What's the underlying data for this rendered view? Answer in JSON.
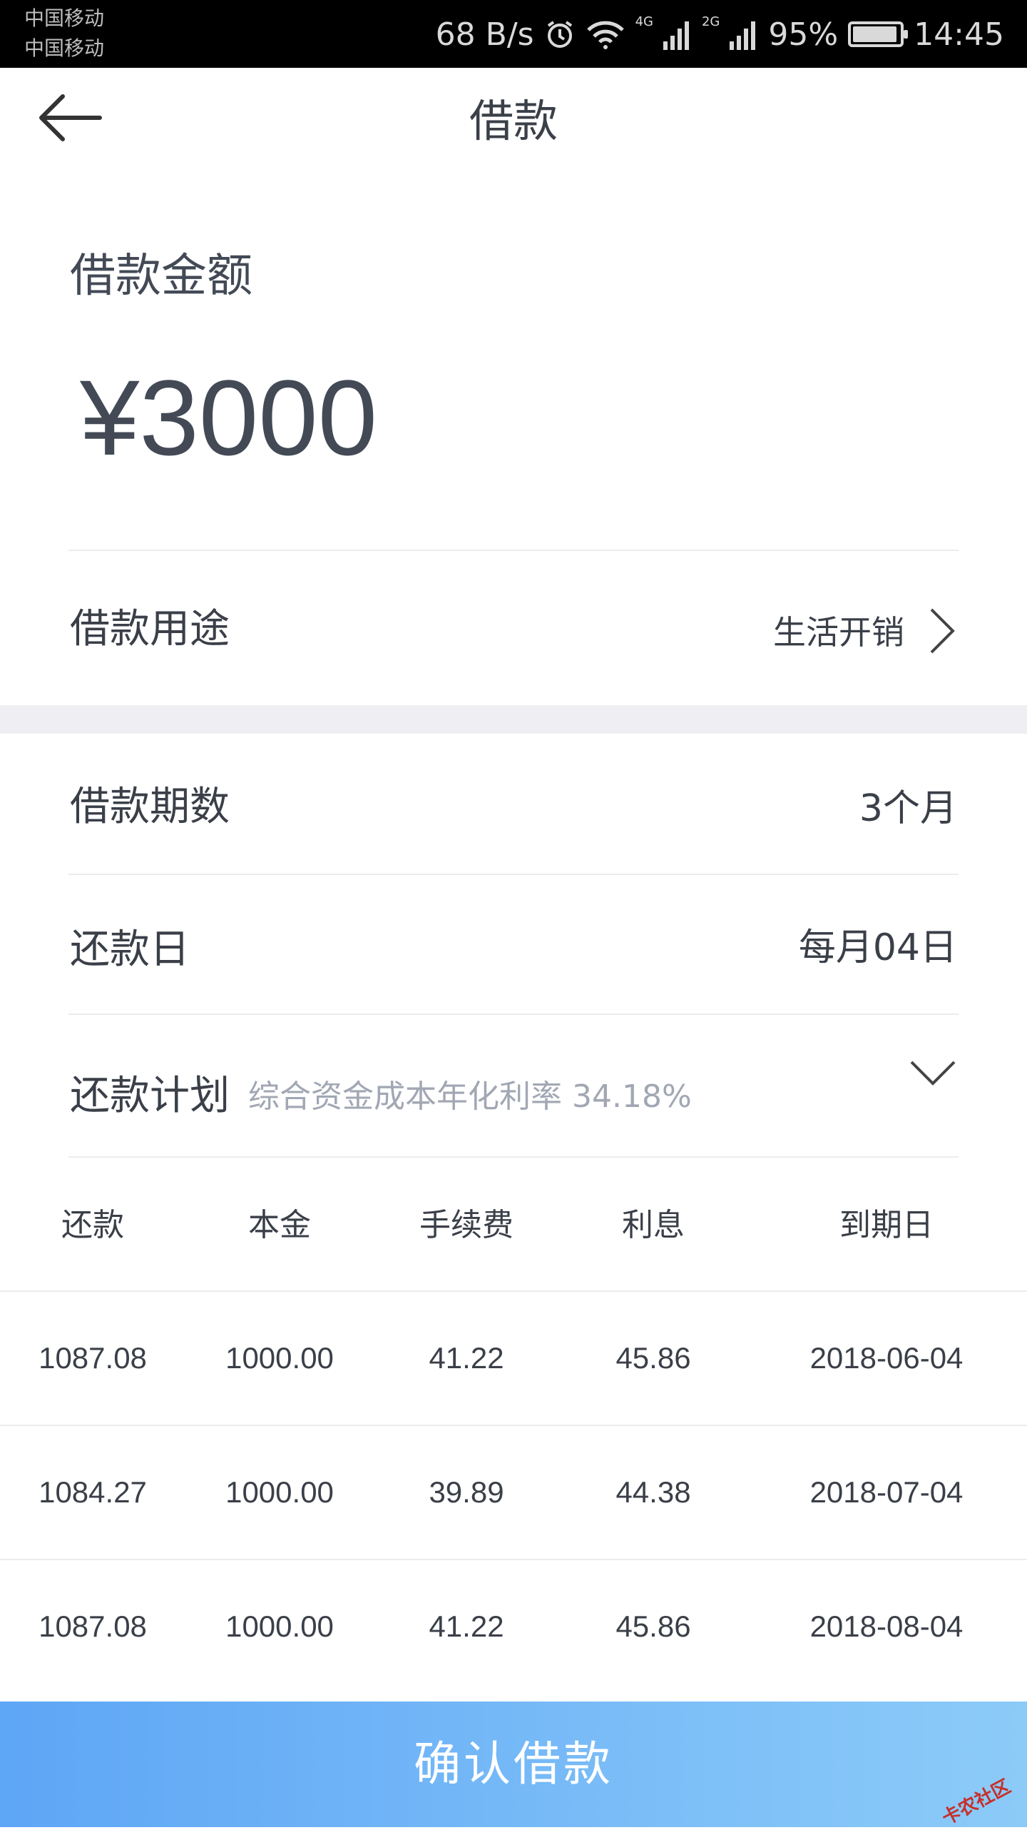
{
  "statusbar": {
    "carrier1": "中国移动",
    "carrier2": "中国移动",
    "net_speed": "68 B/s",
    "net1": "4G",
    "net2": "2G",
    "battery": "95%",
    "battery_level": 0.95,
    "time": "14:45"
  },
  "nav": {
    "title": "借款",
    "back_icon": "arrow-left-icon"
  },
  "loan": {
    "amount_label": "借款金额",
    "amount_value": "¥3000",
    "purpose_label": "借款用途",
    "purpose_value": "生活开销",
    "term_label": "借款期数",
    "term_value": "3个月",
    "due_label": "还款日",
    "due_value": "每月04日",
    "plan_label": "还款计划",
    "plan_rate": "综合资金成本年化利率 34.18%"
  },
  "schedule": {
    "headers": [
      "还款",
      "本金",
      "手续费",
      "利息",
      "到期日"
    ],
    "rows": [
      [
        "1087.08",
        "1000.00",
        "41.22",
        "45.86",
        "2018-06-04"
      ],
      [
        "1084.27",
        "1000.00",
        "39.89",
        "44.38",
        "2018-07-04"
      ],
      [
        "1087.08",
        "1000.00",
        "41.22",
        "45.86",
        "2018-08-04"
      ]
    ]
  },
  "actions": {
    "confirm_label": "确认借款"
  },
  "watermark": "卡农社区",
  "colors": {
    "button_start": "#5ea6f6",
    "button_end": "#8ccbf8",
    "text": "#3a3f48",
    "muted": "#a1a7b3"
  }
}
